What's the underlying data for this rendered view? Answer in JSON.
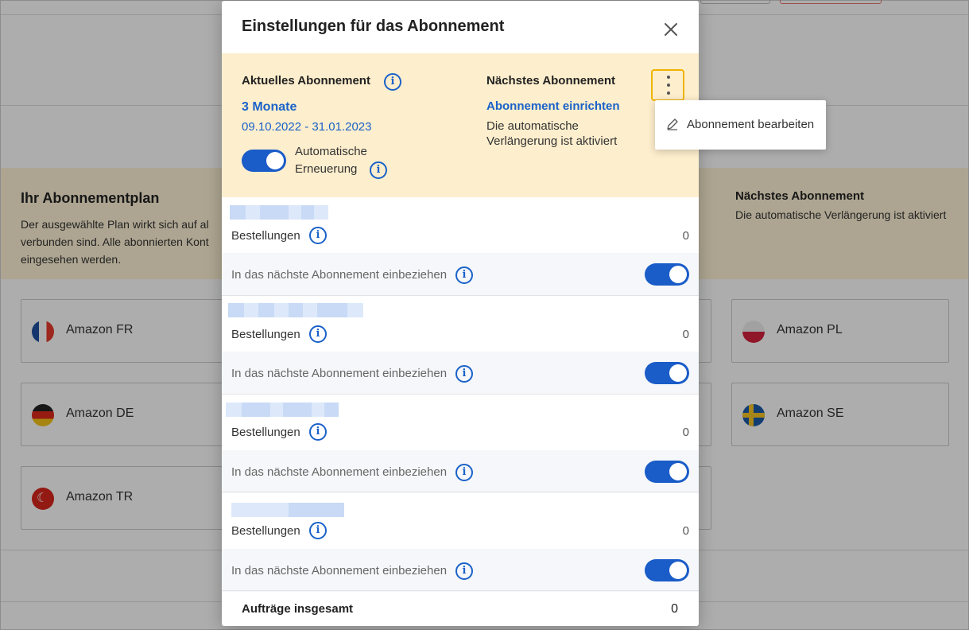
{
  "background": {
    "plan_title": "Ihr Abonnementplan",
    "plan_text_lines": [
      "Der ausgewählte Plan wirkt sich auf al",
      "verbunden sind. Alle abonnierten Kont",
      "eingesehen werden."
    ],
    "next_title": "Nächstes Abonnement",
    "next_text": "Die automatische Verlängerung ist aktiviert",
    "marketplaces": [
      {
        "label": "Amazon FR",
        "flag": "france-flag-icon"
      },
      {
        "label": "Amazon DE",
        "flag": "germany-flag-icon"
      },
      {
        "label": "Amazon TR",
        "flag": "turkey-flag-icon"
      },
      {
        "label": "Amazon PL",
        "flag": "poland-flag-icon"
      },
      {
        "label": "Amazon SE",
        "flag": "sweden-flag-icon"
      }
    ]
  },
  "modal": {
    "title": "Einstellungen für das Abonnement",
    "close_icon": "close-icon",
    "current": {
      "title": "Aktuelles Abonnement",
      "plan": "3 Monate",
      "period": "09.10.2022 - 31.01.2023",
      "auto_renew_line1": "Automatische",
      "auto_renew_line2": "Erneuerung",
      "auto_renew_on": true
    },
    "next": {
      "title": "Nächstes Abonnement",
      "link": "Abonnement einrichten",
      "status_line1": "Die automatische",
      "status_line2": "Verlängerung ist aktiviert"
    },
    "accounts": [
      {
        "orders_label": "Bestellungen",
        "orders_value": "0",
        "include_label": "In das nächste Abonnement einbeziehen",
        "include_on": true
      },
      {
        "orders_label": "Bestellungen",
        "orders_value": "0",
        "include_label": "In das nächste Abonnement einbeziehen",
        "include_on": true
      },
      {
        "orders_label": "Bestellungen",
        "orders_value": "0",
        "include_label": "In das nächste Abonnement einbeziehen",
        "include_on": true
      },
      {
        "orders_label": "Bestellungen",
        "orders_value": "0",
        "include_label": "In das nächste Abonnement einbeziehen",
        "include_on": true
      }
    ],
    "total_label": "Aufträge insgesamt",
    "total_value": "0"
  },
  "menu": {
    "items": [
      {
        "label": "Abonnement bearbeiten",
        "icon": "pencil-icon"
      }
    ]
  },
  "colors": {
    "accent_blue": "#1a62c9",
    "toggle_on": "#1a5cc8",
    "panel_bg": "#fdeecd",
    "kebab_focus": "#f0b400"
  }
}
